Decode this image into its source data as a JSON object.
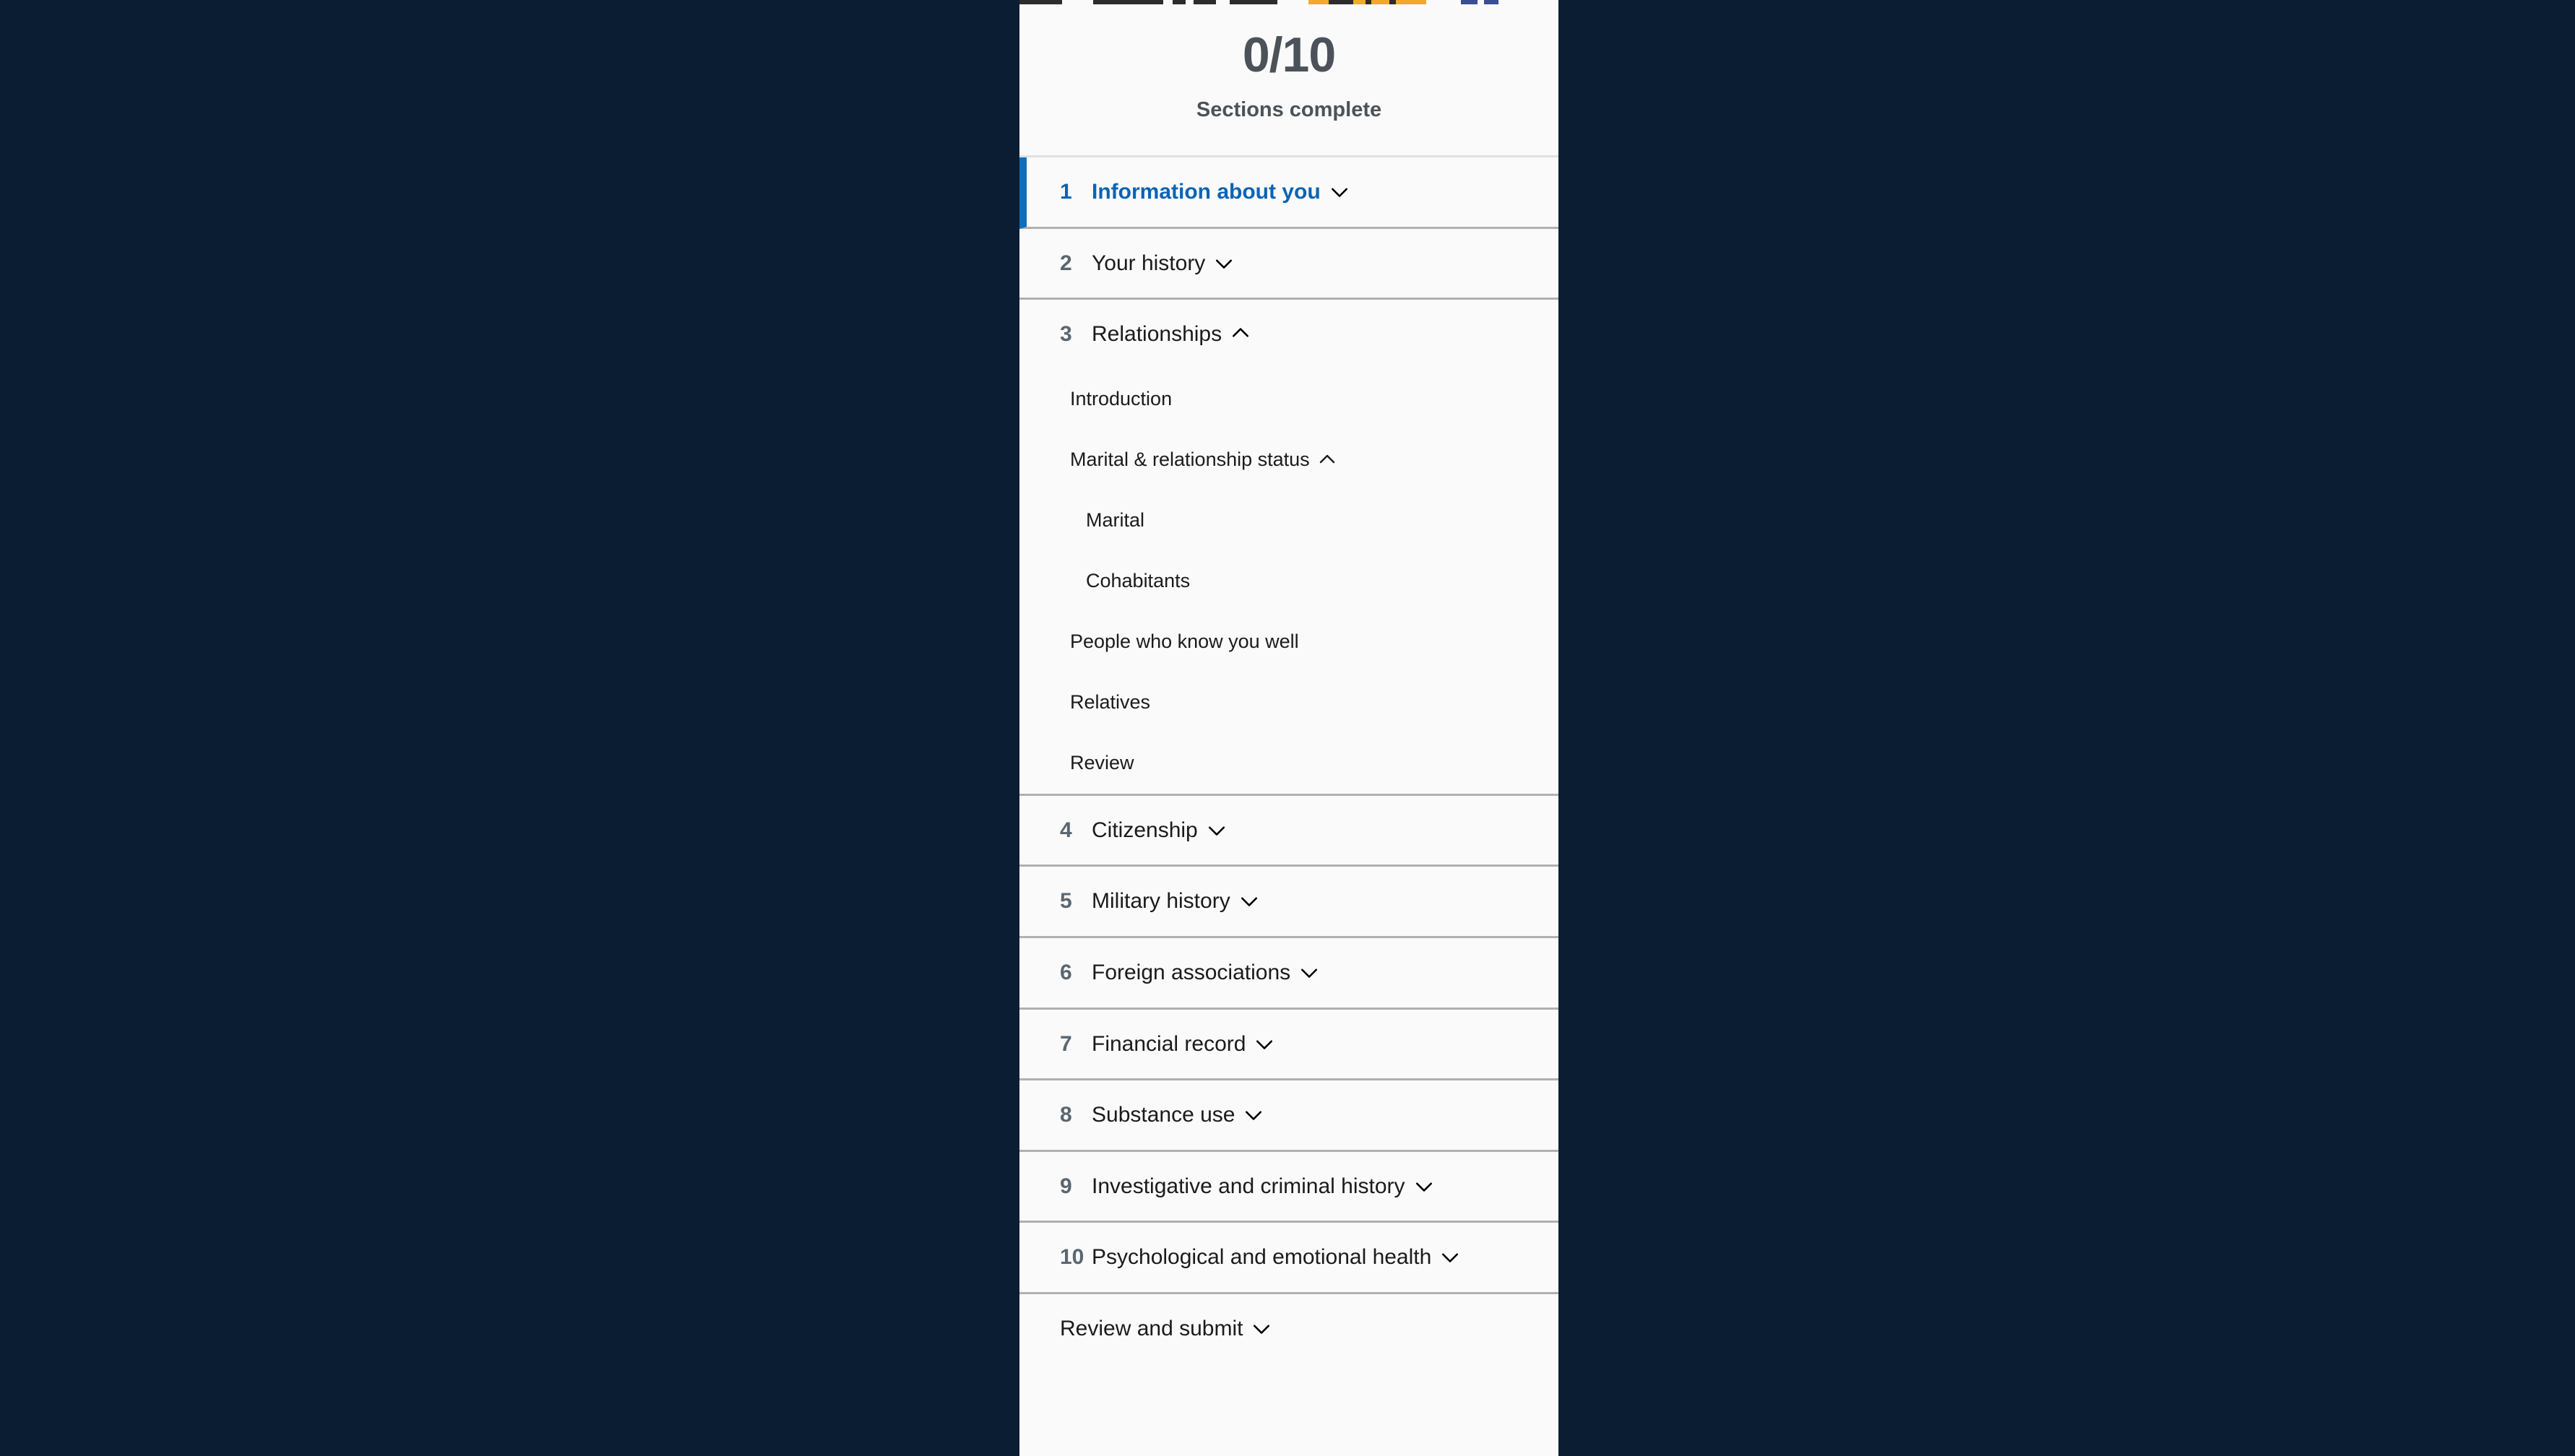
{
  "background_color": "#0b1d33",
  "panel_color": "#fafafa",
  "accent_color": "#0d6ebe",
  "progress": {
    "count": "0/10",
    "label": "Sections complete",
    "clipped_top_row_segments": [
      {
        "color": "#1b1b1b",
        "width": 86
      },
      {
        "color": "#fafafa",
        "width": 62
      },
      {
        "color": "#1b1b1b",
        "width": 140
      },
      {
        "color": "#fafafa",
        "width": 20
      },
      {
        "color": "#1b1b1b",
        "width": 26
      },
      {
        "color": "#fafafa",
        "width": 16
      },
      {
        "color": "#1b1b1b",
        "width": 44
      },
      {
        "color": "#fafafa",
        "width": 28
      },
      {
        "color": "#1b1b1b",
        "width": 96
      },
      {
        "color": "#fafafa",
        "width": 62
      },
      {
        "color": "#f0a31a",
        "width": 40
      },
      {
        "color": "#1b1b1b",
        "width": 50
      },
      {
        "color": "#f0a31a",
        "width": 24
      },
      {
        "color": "#1b1b1b",
        "width": 12
      },
      {
        "color": "#f0a31a",
        "width": 36
      },
      {
        "color": "#1b1b1b",
        "width": 14
      },
      {
        "color": "#f0a31a",
        "width": 60
      },
      {
        "color": "#fafafa",
        "width": 70
      },
      {
        "color": "#2b3f8c",
        "width": 34
      },
      {
        "color": "#fafafa",
        "width": 12
      },
      {
        "color": "#2b3f8c",
        "width": 30
      },
      {
        "color": "#fafafa",
        "width": 120
      }
    ]
  },
  "chapters": [
    {
      "number": "1",
      "title": "Information about you",
      "chevron": "chevron-down",
      "active": true,
      "pages": []
    },
    {
      "number": "2",
      "title": "Your history",
      "chevron": "chevron-down",
      "active": false,
      "pages": []
    },
    {
      "number": "3",
      "title": "Relationships",
      "chevron": "chevron-up",
      "active": false,
      "pages": [
        {
          "label": "Introduction",
          "chevron": null,
          "level": 2,
          "children": []
        },
        {
          "label": "Marital & relationship status",
          "chevron": "chevron-up",
          "level": 2,
          "children": [
            {
              "label": "Marital",
              "chevron": null,
              "level": 3
            },
            {
              "label": "Cohabitants",
              "chevron": null,
              "level": 3
            }
          ]
        },
        {
          "label": "People who know you well",
          "chevron": null,
          "level": 2,
          "children": []
        },
        {
          "label": "Relatives",
          "chevron": null,
          "level": 2,
          "children": []
        },
        {
          "label": "Review",
          "chevron": null,
          "level": 2,
          "children": []
        }
      ]
    },
    {
      "number": "4",
      "title": "Citizenship",
      "chevron": "chevron-down",
      "active": false,
      "pages": []
    },
    {
      "number": "5",
      "title": "Military history",
      "chevron": "chevron-down",
      "active": false,
      "pages": []
    },
    {
      "number": "6",
      "title": "Foreign associations",
      "chevron": "chevron-down",
      "active": false,
      "pages": []
    },
    {
      "number": "7",
      "title": "Financial record",
      "chevron": "chevron-down",
      "active": false,
      "pages": []
    },
    {
      "number": "8",
      "title": "Substance use",
      "chevron": "chevron-down",
      "active": false,
      "pages": []
    },
    {
      "number": "9",
      "title": "Investigative and criminal history",
      "chevron": "chevron-down",
      "active": false,
      "pages": []
    },
    {
      "number": "10",
      "title": "Psychological and emotional health",
      "chevron": "chevron-down",
      "active": false,
      "pages": []
    },
    {
      "number": "",
      "title": "Review and submit",
      "chevron": "chevron-down",
      "active": false,
      "pages": []
    }
  ]
}
